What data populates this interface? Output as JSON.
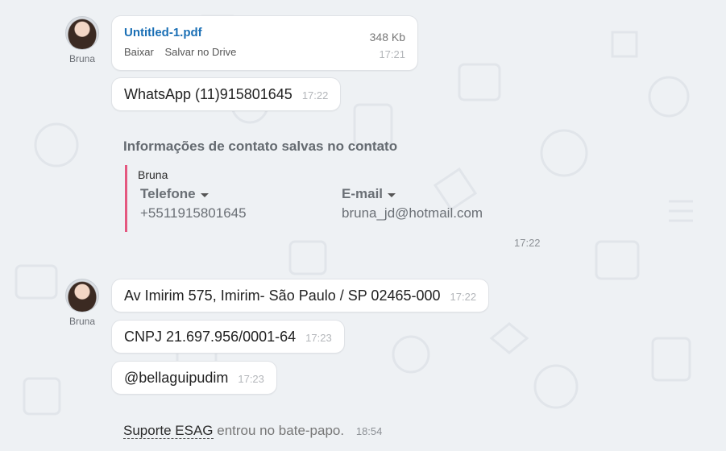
{
  "sender": {
    "name": "Bruna"
  },
  "file_message": {
    "filename": "Untitled-1.pdf",
    "size": "348 Kb",
    "action_download": "Baixar",
    "action_save_drive": "Salvar no Drive",
    "time": "17:21"
  },
  "messages_group1": [
    {
      "text": "WhatsApp (11)915801645",
      "time": "17:22"
    }
  ],
  "contact_info": {
    "title": "Informações de contato salvas no contato",
    "name": "Bruna",
    "phone_label": "Telefone",
    "phone_value": "+5511915801645",
    "email_label": "E-mail",
    "email_value": "bruna_jd@hotmail.com",
    "time": "17:22"
  },
  "messages_group2": [
    {
      "text": "Av Imirim 575, Imirim- São Paulo / SP 02465-000",
      "time": "17:22"
    },
    {
      "text": "CNPJ 21.697.956/0001-64",
      "time": "17:23"
    },
    {
      "text": "@bellaguipudim",
      "time": "17:23"
    }
  ],
  "system_event": {
    "who": "Suporte ESAG",
    "text": "entrou no bate-papo.",
    "time": "18:54"
  },
  "colors": {
    "background": "#eef1f4",
    "link": "#1a6fb5",
    "contact_accent": "#e4577f"
  }
}
